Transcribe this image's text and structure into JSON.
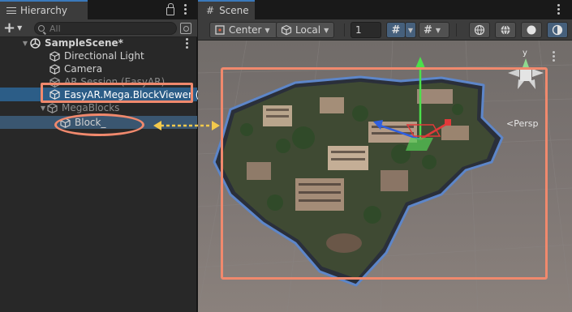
{
  "hierarchy": {
    "tab_label": "Hierarchy",
    "search_placeholder": "All",
    "rows": [
      {
        "label": "SampleScene*"
      },
      {
        "label": "Directional Light"
      },
      {
        "label": "Camera"
      },
      {
        "label": "AR Session (EasyAR)"
      },
      {
        "label": "EasyAR.Mega.BlockViewer ("
      },
      {
        "label": "MegaBlocks"
      },
      {
        "label": "Block_"
      }
    ]
  },
  "scene": {
    "tab_label": "Scene",
    "pivot_label": "Center",
    "space_label": "Local",
    "grid_snap_value": "1",
    "persp_label": "<Persp",
    "gizmo_axis_label": "y"
  },
  "colors": {
    "annotation": "#f0896d",
    "selection": "#2c5d87",
    "tab_accent": "#3a79bb"
  }
}
